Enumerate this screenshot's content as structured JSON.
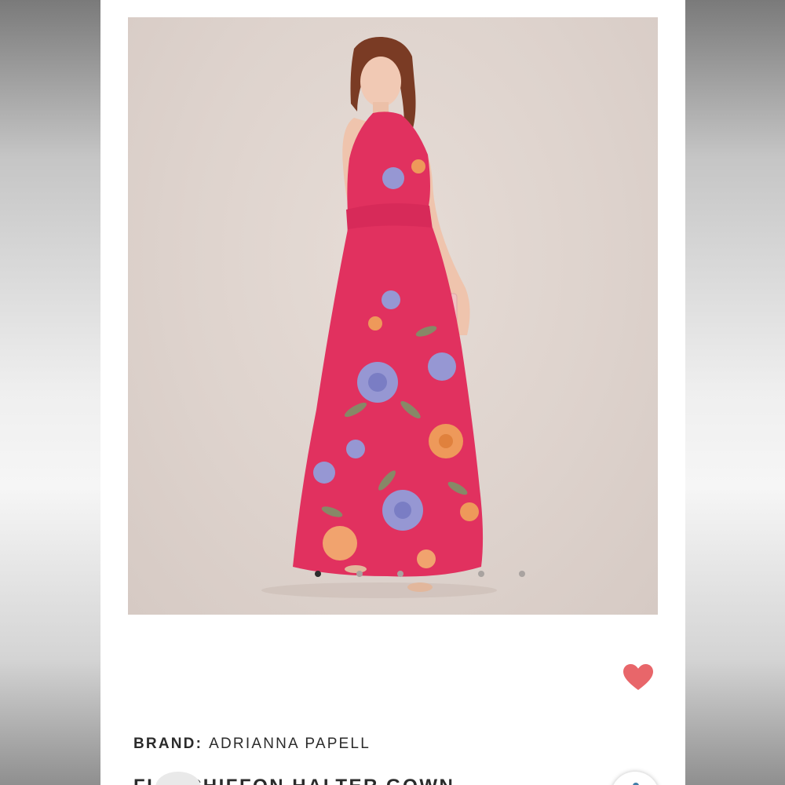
{
  "product": {
    "image_alt": "Model wearing pink floral halter maxi gown",
    "carousel": {
      "total": 5,
      "active": 1
    },
    "brand_label": "BRAND:",
    "brand_value": "ADRIANNA PAPELL",
    "title_visible": "FL    L CHIFFON HALTER GOWN",
    "favorite_icon": "heart-icon"
  },
  "colors": {
    "background": "#ffffff",
    "photo_bg": "#ded3cd",
    "dress": "#e1315f",
    "heart": "#e8666a",
    "text": "#2b2b2b",
    "dot_active": "#2c2c2c",
    "dot_inactive": "#a9a3a0"
  }
}
